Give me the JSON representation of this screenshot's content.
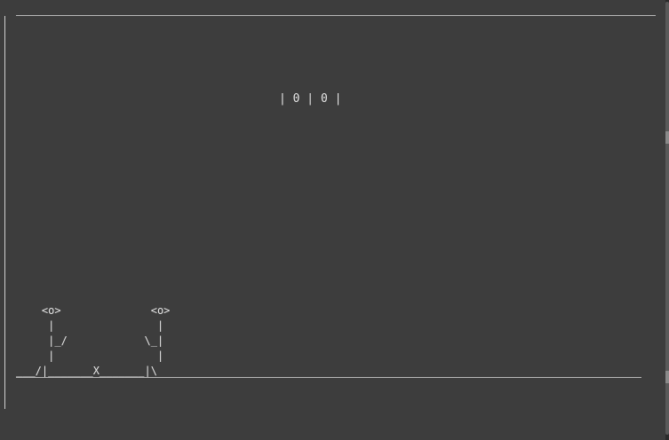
{
  "score": {
    "text": "| 0 | 0 |",
    "left": 0,
    "right": 0
  },
  "scene": {
    "players": [
      {
        "head": "<o>",
        "pose": "|_/"
      },
      {
        "head": "<o>",
        "pose": "\\_|"
      }
    ],
    "ball": "X",
    "art": "    <o>              <o>\n     |                |\n     |_/            \\_|\n     |                |\n___/|_______X_______|\\"
  },
  "colors": {
    "background": "#3d3d3d",
    "text": "#e6e6e6",
    "lines": "#b8b8b8"
  }
}
